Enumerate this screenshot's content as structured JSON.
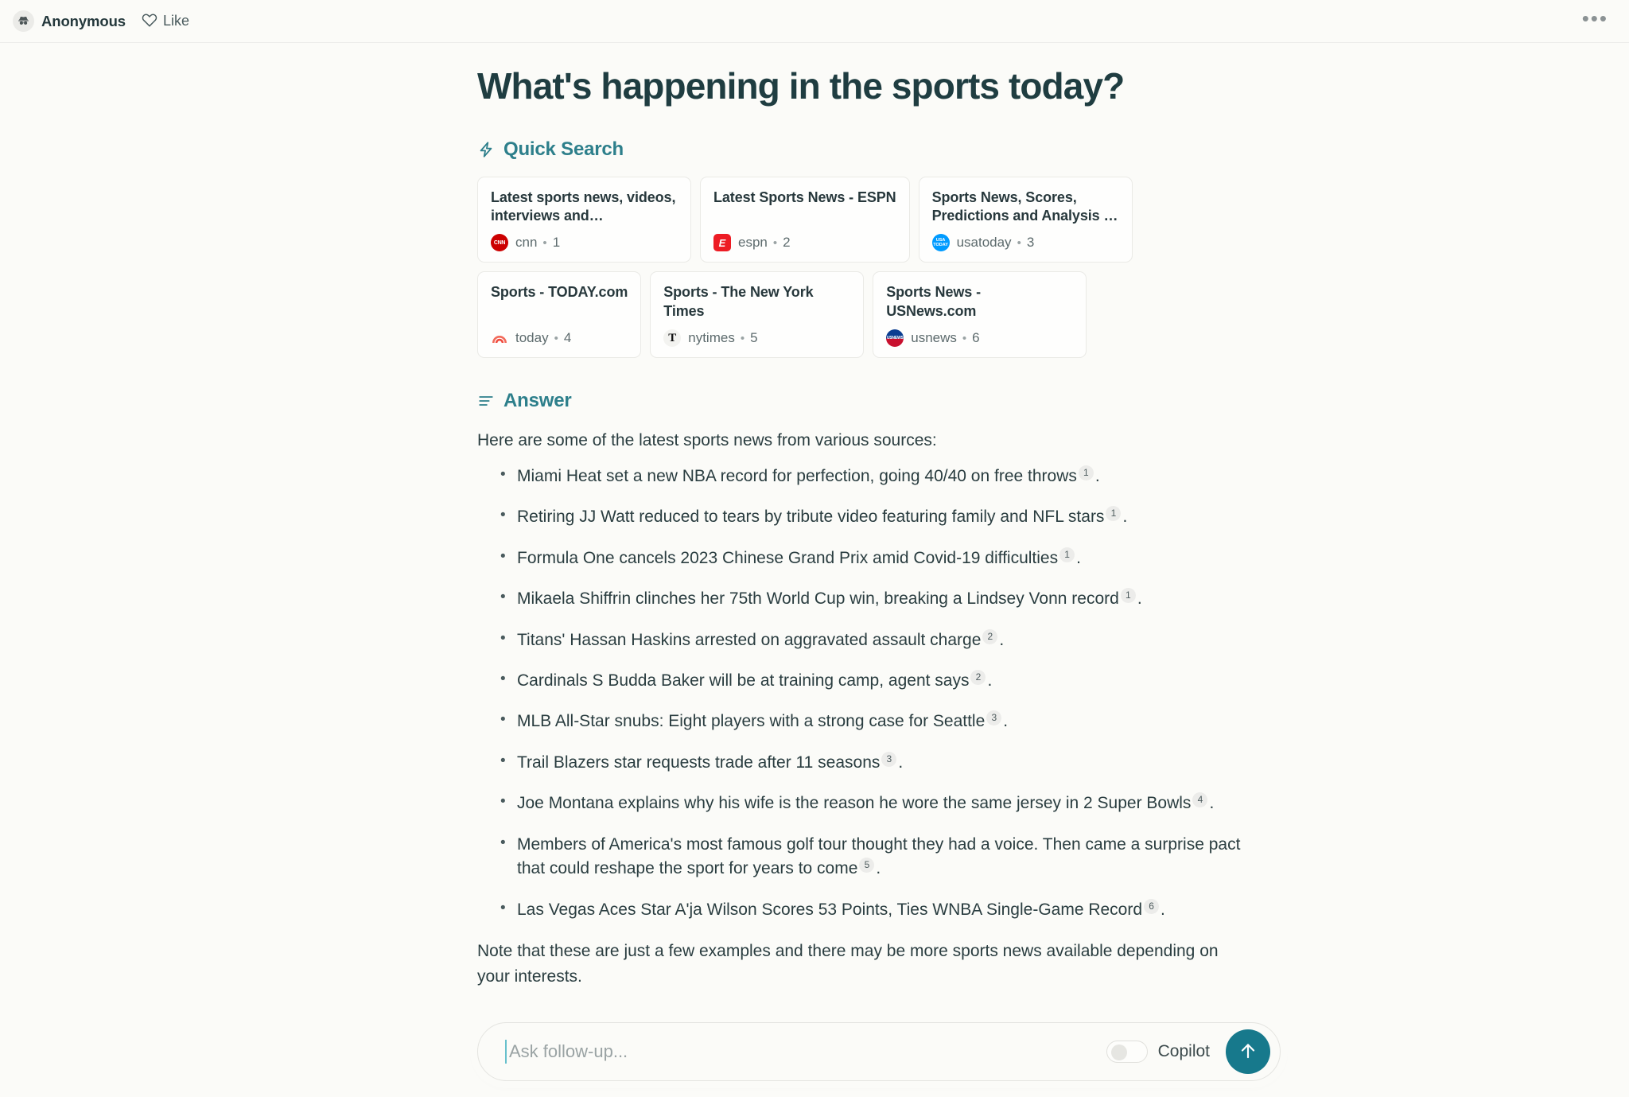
{
  "topbar": {
    "user_name": "Anonymous",
    "avatar_icon": "incognito-avatar-icon",
    "like_label": "Like",
    "like_icon": "heart-icon",
    "more_label": "•••",
    "more_icon": "more-horizontal-icon"
  },
  "page_title": "What's happening in the sports today?",
  "quick_search": {
    "icon": "lightning-bolt-icon",
    "title": "Quick Search",
    "cards": [
      {
        "title": "Latest sports news, videos, interviews and…",
        "source": "cnn",
        "index": "1",
        "favicon": "cnn-logo-icon",
        "favicon_text": "CNN"
      },
      {
        "title": "Latest Sports News - ESPN",
        "source": "espn",
        "index": "2",
        "favicon": "espn-logo-icon",
        "favicon_text": "E"
      },
      {
        "title": "Sports News, Scores, Predictions and Analysis …",
        "source": "usatoday",
        "index": "3",
        "favicon": "usatoday-logo-icon",
        "favicon_text": "USA TODAY"
      },
      {
        "title": "Sports - TODAY.com",
        "source": "today",
        "index": "4",
        "favicon": "today-rainbow-logo-icon",
        "favicon_text": ""
      },
      {
        "title": "Sports - The New York Times",
        "source": "nytimes",
        "index": "5",
        "favicon": "nytimes-logo-icon",
        "favicon_text": "T"
      },
      {
        "title": "Sports News - USNews.com",
        "source": "usnews",
        "index": "6",
        "favicon": "usnews-logo-icon",
        "favicon_text": "USNEWS"
      }
    ],
    "separator": "•"
  },
  "answer": {
    "icon": "answer-lines-icon",
    "title": "Answer",
    "intro": "Here are some of the latest sports news from various sources:",
    "items": [
      {
        "text": "Miami Heat set a new NBA record for perfection, going 40/40 on free throws",
        "cite": "1"
      },
      {
        "text": "Retiring JJ Watt reduced to tears by tribute video featuring family and NFL stars",
        "cite": "1"
      },
      {
        "text": "Formula One cancels 2023 Chinese Grand Prix amid Covid-19 difficulties",
        "cite": "1"
      },
      {
        "text": "Mikaela Shiffrin clinches her 75th World Cup win, breaking a Lindsey Vonn record",
        "cite": "1"
      },
      {
        "text": "Titans' Hassan Haskins arrested on aggravated assault charge",
        "cite": "2"
      },
      {
        "text": "Cardinals S Budda Baker will be at training camp, agent says",
        "cite": "2"
      },
      {
        "text": "MLB All-Star snubs: Eight players with a strong case for Seattle",
        "cite": "3"
      },
      {
        "text": "Trail Blazers star requests trade after 11 seasons",
        "cite": "3"
      },
      {
        "text": "Joe Montana explains why his wife is the reason he wore the same jersey in 2 Super Bowls",
        "cite": "4"
      },
      {
        "text": "Members of America's most famous golf tour thought they had a voice. Then came a surprise pact that could reshape the sport for years to come",
        "cite": "5"
      },
      {
        "text": "Las Vegas Aces Star A'ja Wilson Scores 53 Points, Ties WNBA Single-Game Record",
        "cite": "6"
      }
    ],
    "note": "Note that these are just a few examples and there may be more sports news available depending on your interests.",
    "period": "."
  },
  "followup": {
    "placeholder": "Ask follow-up...",
    "value": "",
    "copilot_label": "Copilot",
    "copilot_enabled": false,
    "send_icon": "arrow-up-icon"
  },
  "colors": {
    "accent": "#2d7f8b",
    "send_button": "#17798c",
    "page_bg": "#fbfbf8",
    "title": "#1f3d41"
  }
}
